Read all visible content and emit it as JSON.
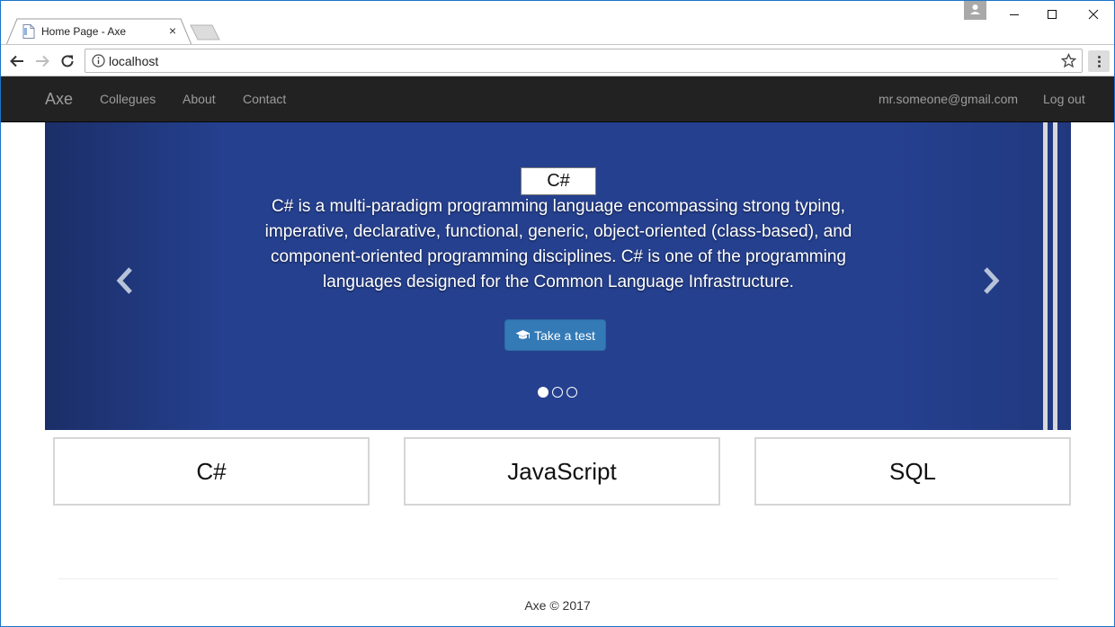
{
  "browser": {
    "tab_title": "Home Page - Axe",
    "tab_close": "×",
    "url": "localhost"
  },
  "navbar": {
    "brand": "Axe",
    "links": [
      "Collegues",
      "About",
      "Contact"
    ],
    "user_email": "mr.someone@gmail.com",
    "logout": "Log out"
  },
  "carousel": {
    "heading": "C#",
    "text": "C# is a multi-paradigm programming language encompassing strong typing, imperative, declarative, functional, generic, object-oriented (class-based), and component-oriented programming disciplines. C# is one of the programming languages designed for the Common Language Infrastructure.",
    "button": "Take a test",
    "slide_count": 3,
    "active_slide": 1
  },
  "cards": [
    "C#",
    "JavaScript",
    "SQL"
  ],
  "footer": {
    "text": "Axe © 2017"
  },
  "colors": {
    "navbar_bg": "#222222",
    "carousel_bg": "#25408f",
    "button_bg": "#337ab7"
  }
}
